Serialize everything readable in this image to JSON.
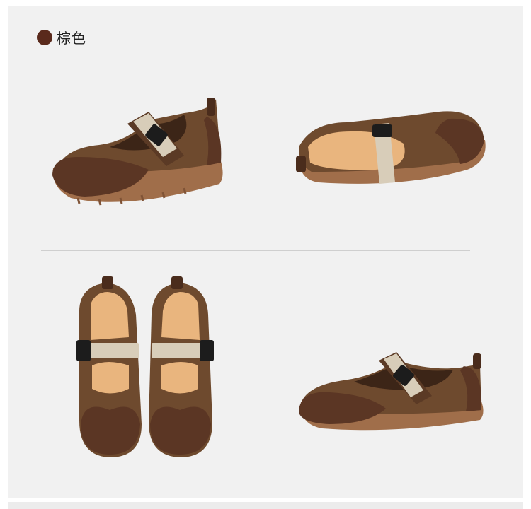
{
  "color_label": {
    "text": "棕色",
    "dot_color": "#5a2a1c"
  },
  "palette": {
    "suede": "#6e4a2e",
    "leather": "#5b3624",
    "sole": "#a06e4a",
    "insole": "#e9b57e",
    "strap": "#d8cdb9",
    "buckle": "#1c1c1c"
  },
  "photos": [
    {
      "name": "shoe-side-left-view"
    },
    {
      "name": "shoe-side-right-view"
    },
    {
      "name": "shoe-pair-top-view"
    },
    {
      "name": "shoe-side-angled-view"
    }
  ]
}
